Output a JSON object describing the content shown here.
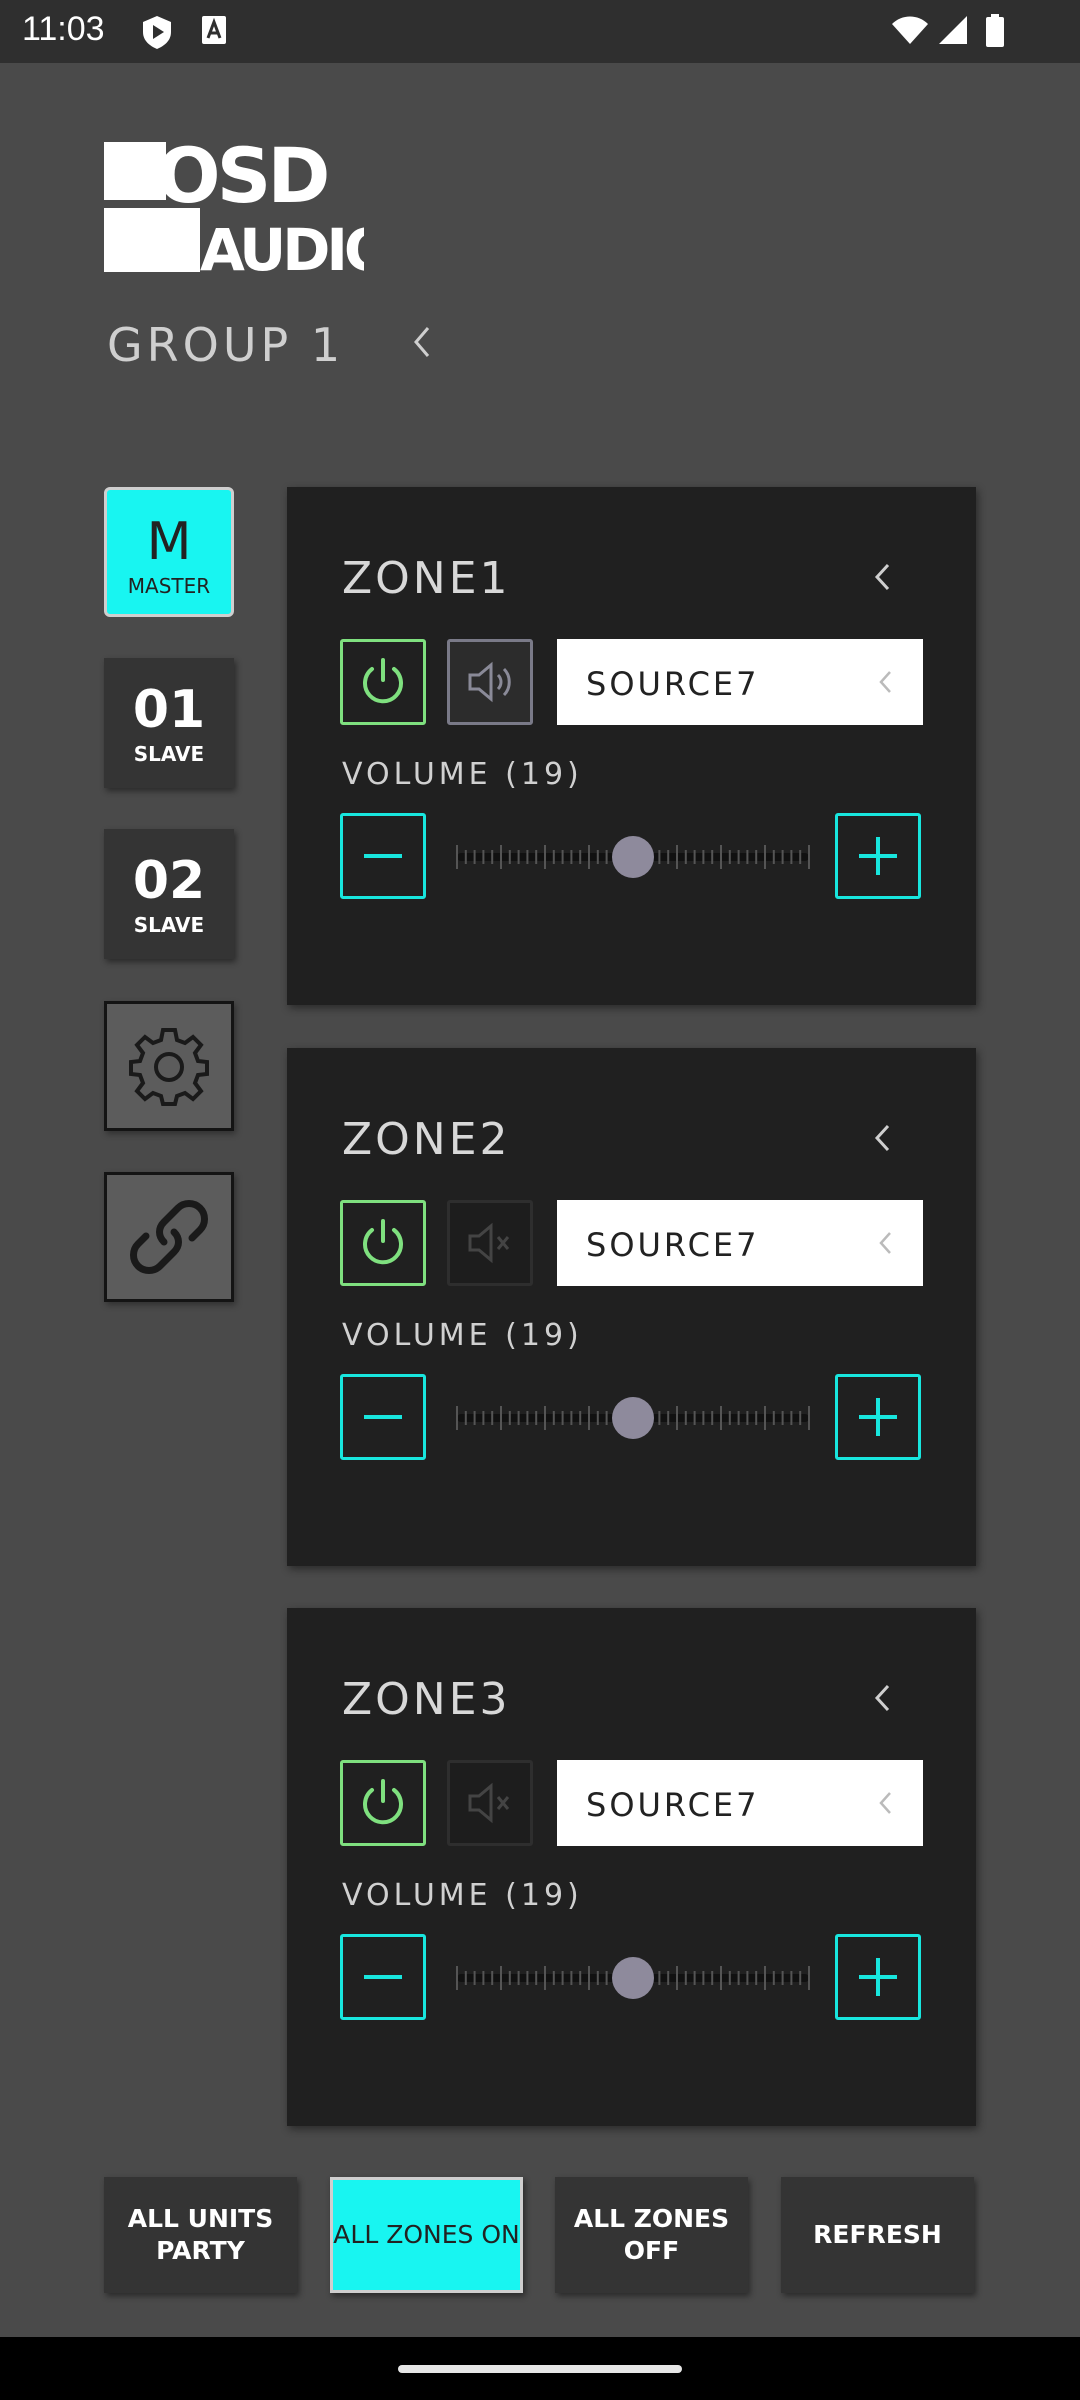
{
  "status_bar": {
    "time": "11:03"
  },
  "logo": {
    "line1": "OSD",
    "line2": "AUDIO"
  },
  "group": {
    "title": "GROUP 1"
  },
  "side": {
    "master": {
      "big": "M",
      "small": "MASTER"
    },
    "slave1": {
      "big": "01",
      "small": "SLAVE"
    },
    "slave2": {
      "big": "02",
      "small": "SLAVE"
    }
  },
  "zones": [
    {
      "name": "ZONE1",
      "source": "SOURCE7",
      "volume_label": "VOLUME  (19)",
      "volume": 19,
      "muted": false
    },
    {
      "name": "ZONE2",
      "source": "SOURCE7",
      "volume_label": "VOLUME  (19)",
      "volume": 19,
      "muted": true
    },
    {
      "name": "ZONE3",
      "source": "SOURCE7",
      "volume_label": "VOLUME  (19)",
      "volume": 19,
      "muted": true
    }
  ],
  "volume_max": 38,
  "bottom": {
    "party": "ALL UNITS PARTY",
    "on": "ALL ZONES ON",
    "off": "ALL ZONES OFF",
    "refresh": "REFRESH"
  },
  "colors": {
    "accent": "#18f5f1",
    "power": "#7fe07f",
    "zone_bg": "#202020",
    "page_bg": "#4a4a4a"
  }
}
